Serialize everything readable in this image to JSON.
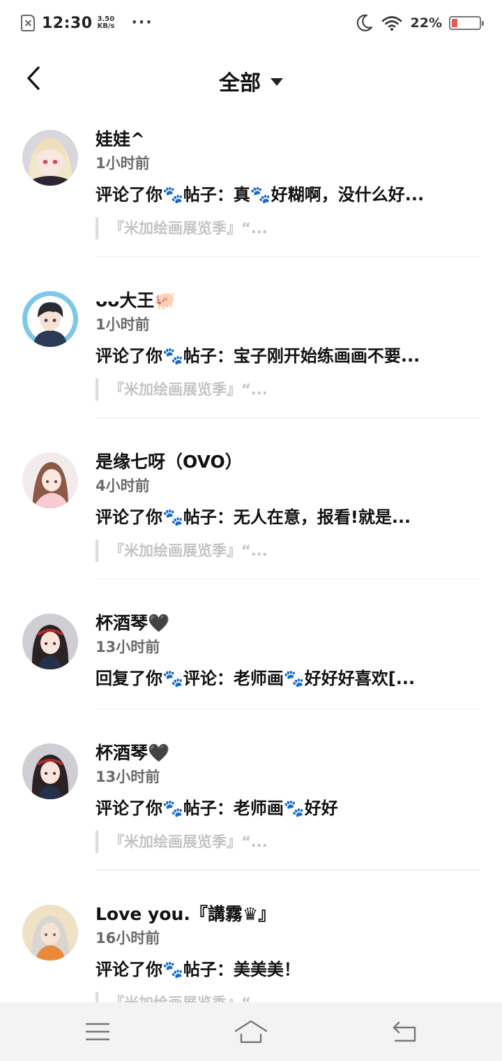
{
  "status_bar": {
    "time": "12:30",
    "speed_value": "3.50",
    "speed_unit": "KB/s",
    "more": "···",
    "battery_percent": "22%",
    "battery_level": 0.22,
    "sim_icon": "sim-off-icon",
    "moon_icon": "do-not-disturb-moon-icon",
    "wifi_icon": "wifi-icon"
  },
  "header": {
    "title": "全部",
    "back_icon": "chevron-left-icon",
    "dropdown_icon": "caret-down-icon"
  },
  "notifications": [
    {
      "name": "娃娃^",
      "time": "1小时前",
      "comment": "评论了你🐾帖子：真🐾好糊啊，没什么好...",
      "quote": "『米加绘画展览季』“..."
    },
    {
      "name": "ᴗᴗ大王🐖",
      "time": "1小时前",
      "comment": "评论了你🐾帖子：宝子刚开始练画画不要...",
      "quote": "『米加绘画展览季』“..."
    },
    {
      "name": "是缘七呀（OVO）",
      "time": "4小时前",
      "comment": "评论了你🐾帖子：无人在意，报看!就是...",
      "quote": "『米加绘画展览季』“..."
    },
    {
      "name": "杯酒琴🖤",
      "time": "13小时前",
      "comment": "回复了你🐾评论：老师画🐾好好好喜欢[...",
      "quote": ""
    },
    {
      "name": "杯酒琴🖤",
      "time": "13小时前",
      "comment": "评论了你🐾帖子：老师画🐾好好",
      "quote": "『米加绘画展览季』“..."
    },
    {
      "name": "Love you.『講霧♛』",
      "time": "16小时前",
      "comment": "评论了你🐾帖子：美美美！",
      "quote": "『米加绘画展览季』“..."
    }
  ],
  "nav_bar": {
    "menu_icon": "menu-icon",
    "home_icon": "home-icon",
    "back_icon": "return-icon"
  },
  "colors": {
    "text": "#111111",
    "muted": "#6b6b6b",
    "quote": "#c4c4c4",
    "battery_low": "#e05b5b",
    "nav_bg": "#f3f3f3"
  }
}
